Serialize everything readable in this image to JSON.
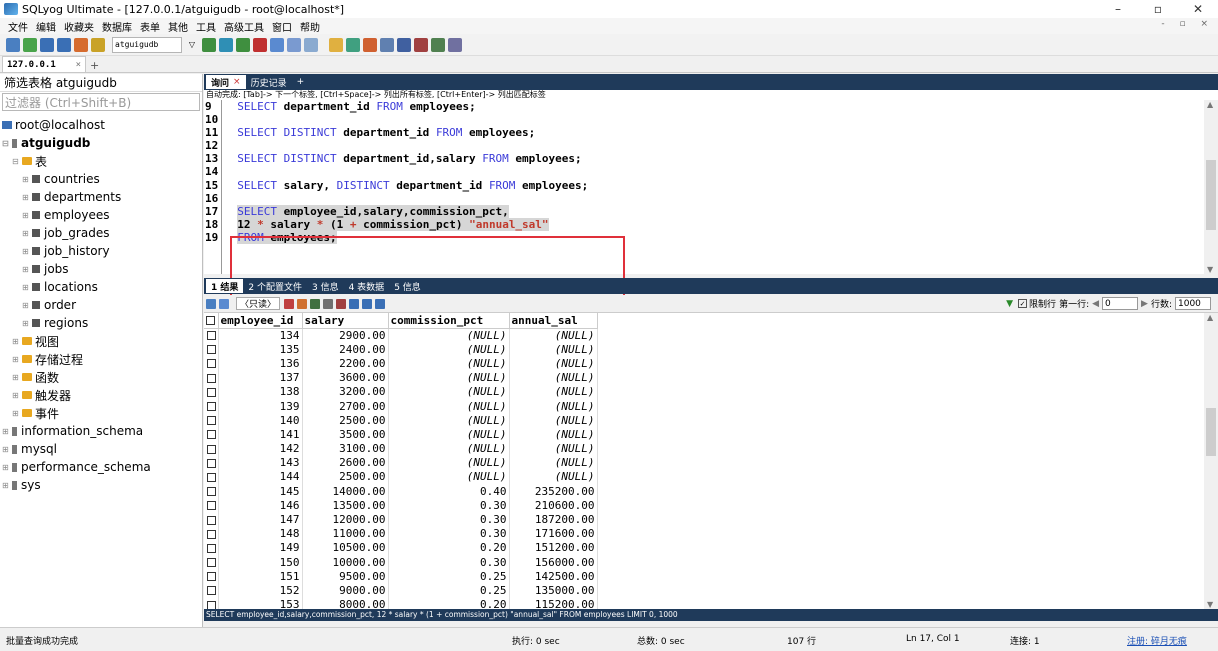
{
  "window": {
    "title": "SQLyog Ultimate - [127.0.0.1/atguigudb - root@localhost*]",
    "minimize": "–",
    "maximize": "▫",
    "close": "✕"
  },
  "menu": [
    "文件",
    "编辑",
    "收藏夹",
    "数据库",
    "表单",
    "其他",
    "工具",
    "高级工具",
    "窗口",
    "帮助"
  ],
  "toolbar": {
    "db_select": "atguigudb"
  },
  "conn_tab": {
    "label": "127.0.0.1",
    "close": "×",
    "add": "+"
  },
  "left_panel": {
    "header": "筛选表格 atguigudb",
    "filter_placeholder": "过滤器 (Ctrl+Shift+B)",
    "server": "root@localhost",
    "db": "atguigudb",
    "tables_folder": "表",
    "tables": [
      "countries",
      "departments",
      "employees",
      "job_grades",
      "job_history",
      "jobs",
      "locations",
      "order",
      "regions"
    ],
    "folders": [
      "视图",
      "存储过程",
      "函数",
      "触发器",
      "事件"
    ],
    "other_dbs": [
      "information_schema",
      "mysql",
      "performance_schema",
      "sys"
    ]
  },
  "editor": {
    "tabs": [
      {
        "label": "询问",
        "close": "×"
      },
      {
        "label": "历史记录"
      },
      {
        "label": "+"
      }
    ],
    "hint": "自动完成: [Tab]-> 下一个标签, [Ctrl+Space]-> 列出所有标签, [Ctrl+Enter]-> 列出匹配标签",
    "line_numbers": [
      "9",
      "10",
      "11",
      "12",
      "13",
      "14",
      "15",
      "16",
      "17",
      "18",
      "19"
    ]
  },
  "results": {
    "tabs": [
      "1 结果",
      "2 个配置文件",
      "3 信息",
      "4 表数据",
      "5 信息"
    ],
    "readonly": "〈只读〉",
    "limit_label": "限制行",
    "first_row_label": "第一行:",
    "first_row": "0",
    "rows_label": "行数:",
    "rows_value": "1000",
    "columns": [
      "employee_id",
      "salary",
      "commission_pct",
      "annual_sal"
    ],
    "rows": [
      [
        "134",
        "2900.00",
        "(NULL)",
        "(NULL)"
      ],
      [
        "135",
        "2400.00",
        "(NULL)",
        "(NULL)"
      ],
      [
        "136",
        "2200.00",
        "(NULL)",
        "(NULL)"
      ],
      [
        "137",
        "3600.00",
        "(NULL)",
        "(NULL)"
      ],
      [
        "138",
        "3200.00",
        "(NULL)",
        "(NULL)"
      ],
      [
        "139",
        "2700.00",
        "(NULL)",
        "(NULL)"
      ],
      [
        "140",
        "2500.00",
        "(NULL)",
        "(NULL)"
      ],
      [
        "141",
        "3500.00",
        "(NULL)",
        "(NULL)"
      ],
      [
        "142",
        "3100.00",
        "(NULL)",
        "(NULL)"
      ],
      [
        "143",
        "2600.00",
        "(NULL)",
        "(NULL)"
      ],
      [
        "144",
        "2500.00",
        "(NULL)",
        "(NULL)"
      ],
      [
        "145",
        "14000.00",
        "0.40",
        "235200.00"
      ],
      [
        "146",
        "13500.00",
        "0.30",
        "210600.00"
      ],
      [
        "147",
        "12000.00",
        "0.30",
        "187200.00"
      ],
      [
        "148",
        "11000.00",
        "0.30",
        "171600.00"
      ],
      [
        "149",
        "10500.00",
        "0.20",
        "151200.00"
      ],
      [
        "150",
        "10000.00",
        "0.30",
        "156000.00"
      ],
      [
        "151",
        "9500.00",
        "0.25",
        "142500.00"
      ],
      [
        "152",
        "9000.00",
        "0.25",
        "135000.00"
      ],
      [
        "153",
        "8000.00",
        "0.20",
        "115200.00"
      ]
    ],
    "sql_footer": "SELECT employee_id,salary,commission_pct, 12 * salary * (1 + commission_pct) \"annual_sal\" FROM employees LIMIT 0, 1000"
  },
  "status": {
    "left": "批量查询成功完成",
    "exec": "执行: 0 sec",
    "total": "总数: 0 sec",
    "rows": "107 行",
    "pos": "Ln 17, Col 1",
    "conn": "连接: 1",
    "register": "注册: 碎月无痕"
  }
}
